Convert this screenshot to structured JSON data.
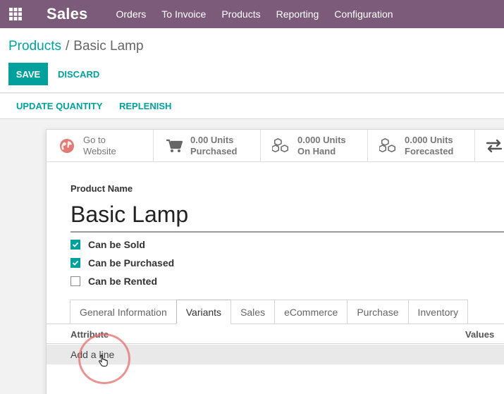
{
  "navbar": {
    "app_name": "Sales",
    "menu": [
      "Orders",
      "To Invoice",
      "Products",
      "Reporting",
      "Configuration"
    ],
    "apps_icon": "grid-icon",
    "bg_color": "#7c5a79"
  },
  "breadcrumb": {
    "parent": "Products",
    "separator": "/",
    "current": "Basic Lamp"
  },
  "buttons": {
    "save": "SAVE",
    "discard": "DISCARD"
  },
  "actions": {
    "update_quantity": "UPDATE QUANTITY",
    "replenish": "REPLENISH"
  },
  "smart_buttons": [
    {
      "icon": "globe-icon",
      "line1": "Go to",
      "line2": "Website"
    },
    {
      "icon": "cart-icon",
      "line1": "0.00 Units",
      "line2": "Purchased"
    },
    {
      "icon": "cubes-icon",
      "line1": "0.000 Units",
      "line2": "On Hand"
    },
    {
      "icon": "cubes-icon",
      "line1": "0.000 Units",
      "line2": "Forecasted"
    }
  ],
  "form": {
    "product_name_label": "Product Name",
    "product_name": "Basic Lamp",
    "checkboxes": [
      {
        "label": "Can be Sold",
        "checked": true
      },
      {
        "label": "Can be Purchased",
        "checked": true
      },
      {
        "label": "Can be Rented",
        "checked": false
      }
    ]
  },
  "tabs": [
    "General Information",
    "Variants",
    "Sales",
    "eCommerce",
    "Purchase",
    "Inventory"
  ],
  "active_tab": "Variants",
  "variants_table": {
    "col_attribute": "Attribute",
    "col_values": "Values",
    "add_line": "Add a line"
  },
  "accent_color": "#00a09d"
}
